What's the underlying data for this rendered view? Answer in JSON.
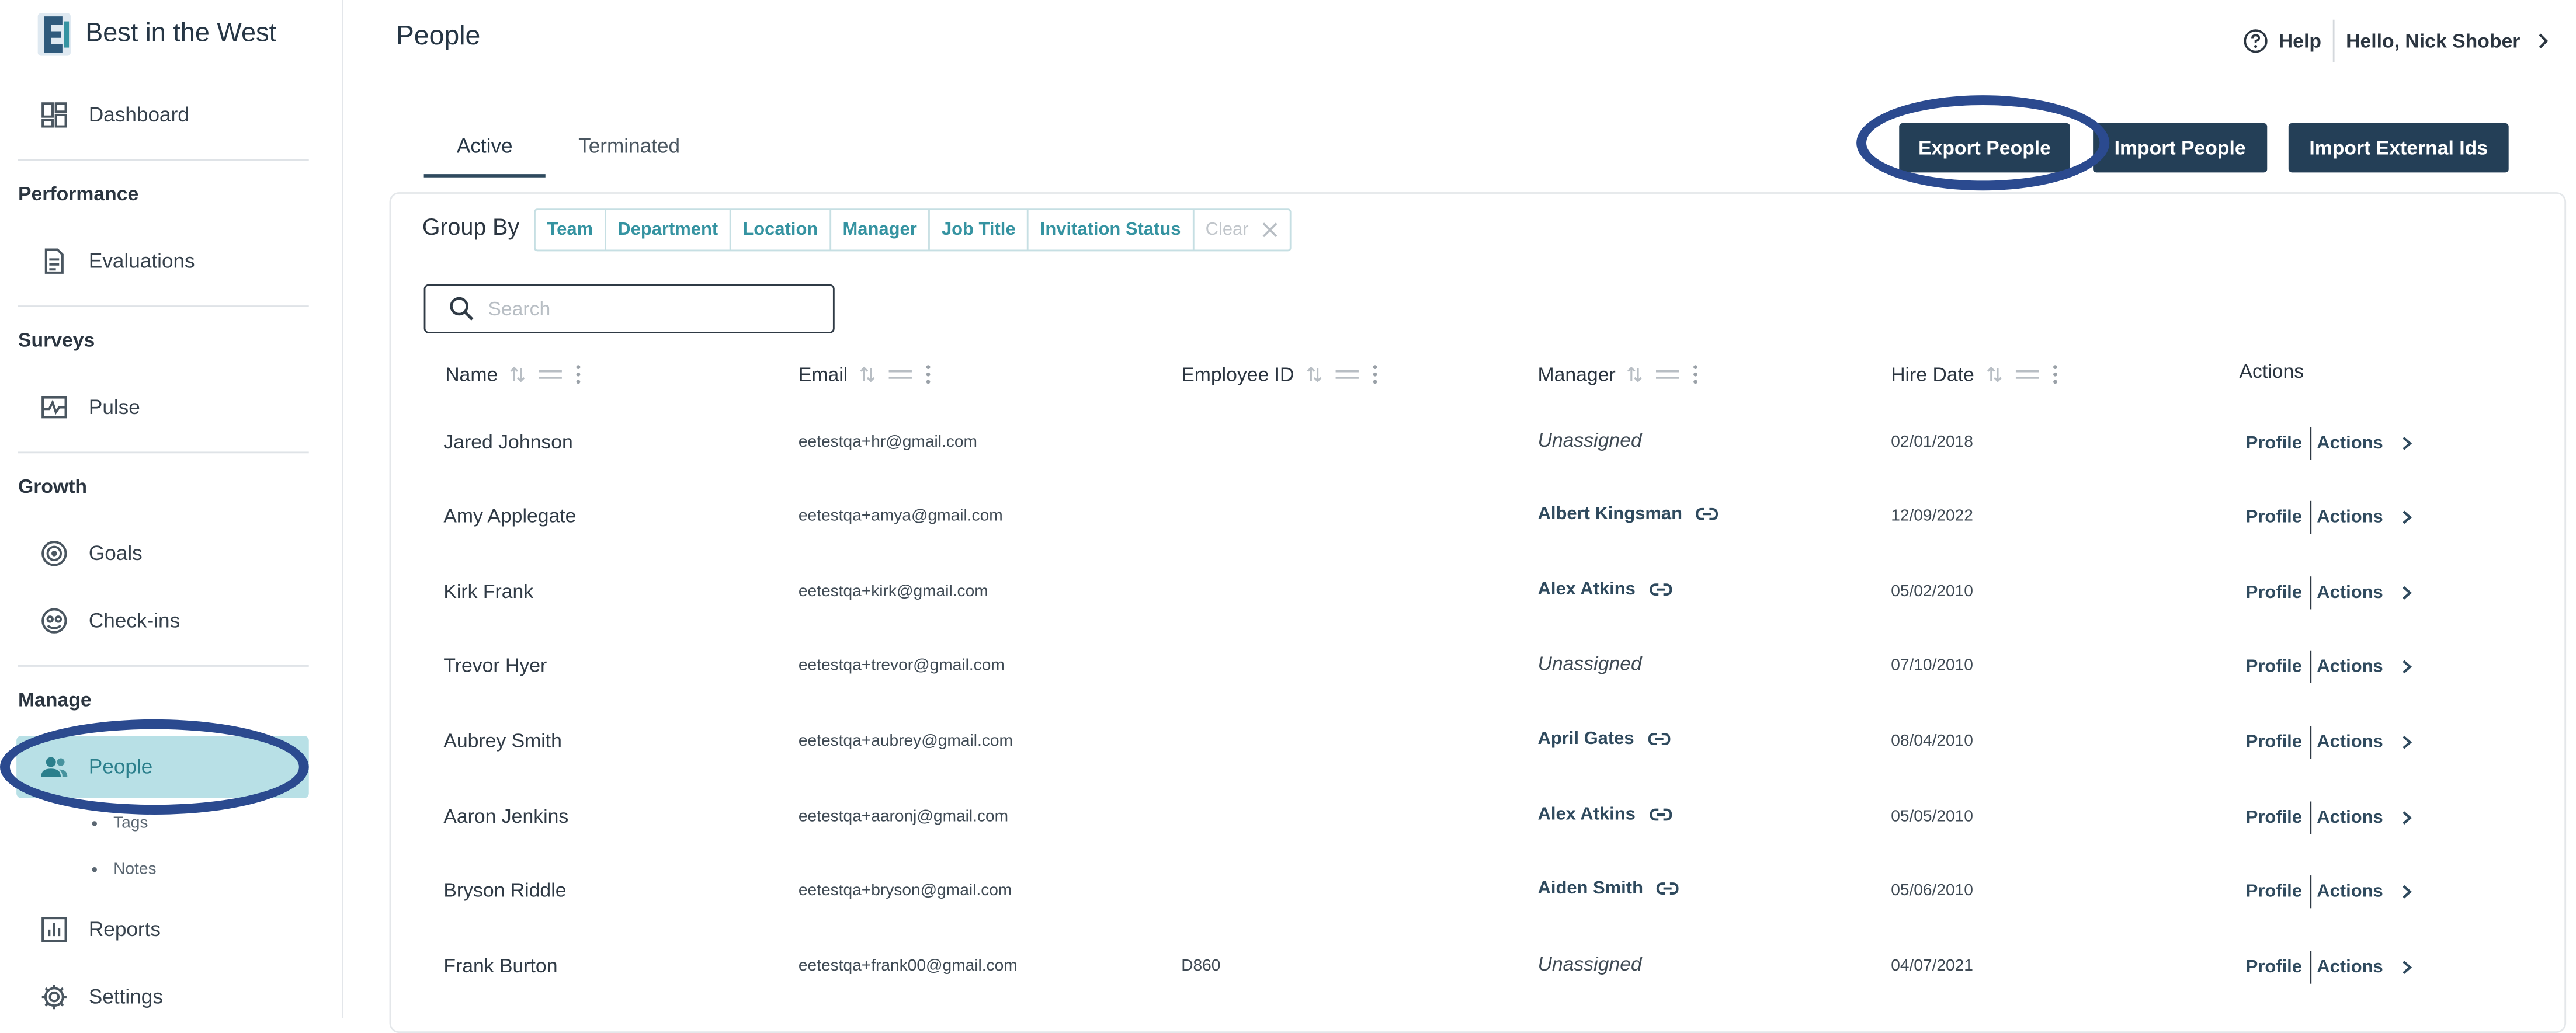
{
  "app": {
    "brand": "Best in the West"
  },
  "sidebar": {
    "dashboard": "Dashboard",
    "sections": {
      "performance": "Performance",
      "surveys": "Surveys",
      "growth": "Growth",
      "manage": "Manage"
    },
    "evaluations": "Evaluations",
    "pulse": "Pulse",
    "goals": "Goals",
    "checkins": "Check-ins",
    "people": "People",
    "tags": "Tags",
    "notes": "Notes",
    "reports": "Reports",
    "settings": "Settings"
  },
  "header": {
    "title": "People",
    "help": "Help",
    "user": "Hello, Nick Shober"
  },
  "tabs": {
    "active": "Active",
    "terminated": "Terminated"
  },
  "buttons": {
    "export": "Export People",
    "import": "Import People",
    "import_external": "Import External Ids"
  },
  "groupby": {
    "label": "Group By",
    "chips": [
      "Team",
      "Department",
      "Location",
      "Manager",
      "Job Title",
      "Invitation Status"
    ],
    "clear": "Clear"
  },
  "search": {
    "placeholder": "Search",
    "value": ""
  },
  "table": {
    "headers": {
      "name": "Name",
      "email": "Email",
      "employee_id": "Employee ID",
      "manager": "Manager",
      "hire_date": "Hire Date",
      "actions": "Actions"
    },
    "action_labels": {
      "profile": "Profile",
      "actions": "Actions"
    },
    "rows": [
      {
        "name": "Jared Johnson",
        "email": "eetestqa+hr@gmail.com",
        "employee_id": "",
        "manager": "Unassigned",
        "assigned": false,
        "hire_date": "02/01/2018"
      },
      {
        "name": "Amy Applegate",
        "email": "eetestqa+amya@gmail.com",
        "employee_id": "",
        "manager": "Albert Kingsman",
        "assigned": true,
        "hire_date": "12/09/2022"
      },
      {
        "name": "Kirk Frank",
        "email": "eetestqa+kirk@gmail.com",
        "employee_id": "",
        "manager": "Alex Atkins",
        "assigned": true,
        "hire_date": "05/02/2010"
      },
      {
        "name": "Trevor Hyer",
        "email": "eetestqa+trevor@gmail.com",
        "employee_id": "",
        "manager": "Unassigned",
        "assigned": false,
        "hire_date": "07/10/2010"
      },
      {
        "name": "Aubrey Smith",
        "email": "eetestqa+aubrey@gmail.com",
        "employee_id": "",
        "manager": "April Gates",
        "assigned": true,
        "hire_date": "08/04/2010"
      },
      {
        "name": "Aaron Jenkins",
        "email": "eetestqa+aaronj@gmail.com",
        "employee_id": "",
        "manager": "Alex Atkins",
        "assigned": true,
        "hire_date": "05/05/2010"
      },
      {
        "name": "Bryson Riddle",
        "email": "eetestqa+bryson@gmail.com",
        "employee_id": "",
        "manager": "Aiden Smith",
        "assigned": true,
        "hire_date": "05/06/2010"
      },
      {
        "name": "Frank Burton",
        "email": "eetestqa+frank00@gmail.com",
        "employee_id": "D860",
        "manager": "Unassigned",
        "assigned": false,
        "hire_date": "04/07/2021"
      }
    ]
  },
  "colors": {
    "accent": "#3593a1",
    "primary_button": "#243f57",
    "highlight_ring": "#2b4a8f",
    "active_nav": "#b8e0e6"
  }
}
